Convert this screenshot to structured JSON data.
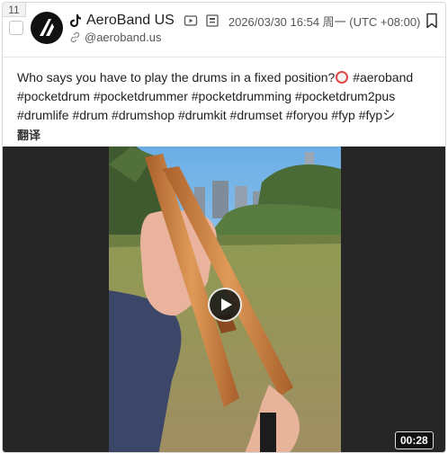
{
  "post": {
    "index": "11",
    "author": {
      "name": "AeroBand US",
      "handle": "@aeroband.us",
      "platform_icon": "tiktok-icon",
      "avatar_icon": "aeroband-logo"
    },
    "timestamp": "2026/03/30 16:54 周一 (UTC +08:00)",
    "text_lines": [
      "Who says you have to play the drums in a fixed position?",
      " #aeroband",
      "#pocketdrum #pocketdrummer #pocketdrumming #pocketdrum2pus",
      "#drumlife #drum #drumshop #drumkit #drumset #foryou #fyp #fypシ"
    ],
    "emoji_icon": "drum-emoji",
    "translate_label": "翻译",
    "media": {
      "duration": "00:28",
      "icons": [
        "video-icon",
        "image-icon",
        "play-icon",
        "bookmark-icon",
        "link-icon"
      ]
    }
  },
  "colors": {
    "text": "#1f1f1f",
    "muted": "#555555",
    "media_bg": "#262626",
    "sky": "#8ec2ea",
    "grass": "#8a8a4a",
    "stick": "#c97b3c"
  }
}
